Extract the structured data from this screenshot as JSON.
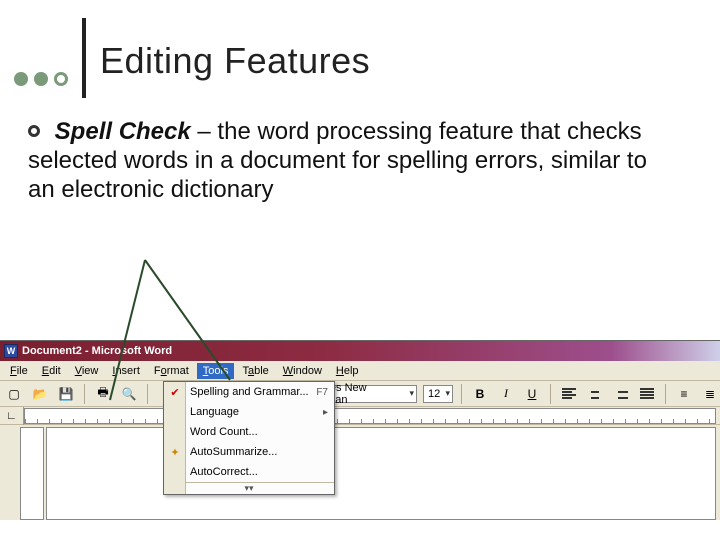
{
  "slide": {
    "title": "Editing Features",
    "bullet": {
      "term": "Spell Check",
      "sep": " – ",
      "text": "the word processing feature that checks selected words in a document for spelling errors, similar to an electronic dictionary"
    }
  },
  "word": {
    "title": "Document2 - Microsoft Word",
    "menu": {
      "file": "File",
      "edit": "Edit",
      "view": "View",
      "insert": "Insert",
      "format": "Format",
      "tools": "Tools",
      "table": "Table",
      "window": "Window",
      "help": "Help"
    },
    "toolbar": {
      "font": "Times New Roman",
      "size": "12",
      "bold": "B",
      "italic": "I",
      "underline": "U"
    },
    "tools_menu": {
      "spelling": {
        "label": "Spelling and Grammar...",
        "shortcut": "F7"
      },
      "language": {
        "label": "Language"
      },
      "wordcount": {
        "label": "Word Count..."
      },
      "autosummarize": {
        "label": "AutoSummarize..."
      },
      "autocorrect": {
        "label": "AutoCorrect..."
      }
    }
  }
}
